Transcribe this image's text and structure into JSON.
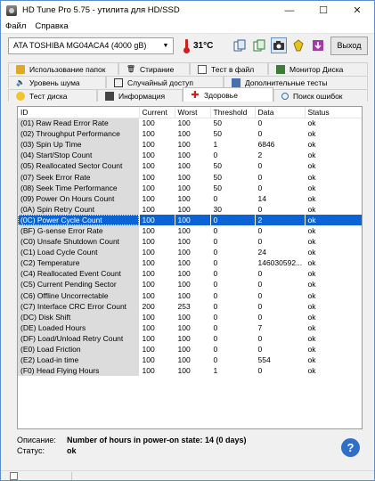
{
  "window": {
    "title": "HD Tune Pro 5.75 - утилита для HD/SSD"
  },
  "controls": {
    "minimize": "—",
    "maximize": "☐",
    "close": "✕"
  },
  "menu": [
    {
      "label": "Файл"
    },
    {
      "label": "Справка"
    }
  ],
  "toolbar": {
    "drive": "ATA    TOSHIBA MG04ACA4 (4000 gB)",
    "temperature": "31°C",
    "exit_label": "Выход",
    "icons": [
      "copy-icon",
      "copy-all-icon",
      "camera-icon",
      "star-icon",
      "download-icon"
    ]
  },
  "tabs": {
    "row1": [
      {
        "label": "Использование папок",
        "icon": "folder-icon"
      },
      {
        "label": "Стирание",
        "icon": "trash-icon"
      },
      {
        "label": "Тест в файл",
        "icon": "file-icon"
      },
      {
        "label": "Монитор Диска",
        "icon": "monitor-icon"
      }
    ],
    "row2": [
      {
        "label": "Уровень шума",
        "icon": "speaker-icon"
      },
      {
        "label": "Случайный доступ",
        "icon": "random-access-icon"
      },
      {
        "label": "Дополнительные  тесты",
        "icon": "tests-icon"
      }
    ],
    "row3": [
      {
        "label": "Тест диска",
        "icon": "bulb-icon"
      },
      {
        "label": "Информация",
        "icon": "info-icon"
      },
      {
        "label": "Здоровье",
        "icon": "health-cross-icon",
        "active": true
      },
      {
        "label": "Поиск ошибок",
        "icon": "magnifier-icon"
      }
    ]
  },
  "table": {
    "columns": [
      "ID",
      "Current",
      "Worst",
      "Threshold",
      "Data",
      "Status"
    ],
    "selected_index": 9,
    "rows": [
      [
        "(01) Raw Read Error Rate",
        "100",
        "100",
        "50",
        "0",
        "ok"
      ],
      [
        "(02) Throughput Performance",
        "100",
        "100",
        "50",
        "0",
        "ok"
      ],
      [
        "(03) Spin Up Time",
        "100",
        "100",
        "1",
        "6846",
        "ok"
      ],
      [
        "(04) Start/Stop Count",
        "100",
        "100",
        "0",
        "2",
        "ok"
      ],
      [
        "(05) Reallocated Sector Count",
        "100",
        "100",
        "50",
        "0",
        "ok"
      ],
      [
        "(07) Seek Error Rate",
        "100",
        "100",
        "50",
        "0",
        "ok"
      ],
      [
        "(08) Seek Time Performance",
        "100",
        "100",
        "50",
        "0",
        "ok"
      ],
      [
        "(09) Power On Hours Count",
        "100",
        "100",
        "0",
        "14",
        "ok"
      ],
      [
        "(0A) Spin Retry Count",
        "100",
        "100",
        "30",
        "0",
        "ok"
      ],
      [
        "(0C) Power Cycle Count",
        "100",
        "100",
        "0",
        "2",
        "ok"
      ],
      [
        "(BF) G-sense Error Rate",
        "100",
        "100",
        "0",
        "0",
        "ok"
      ],
      [
        "(C0) Unsafe Shutdown Count",
        "100",
        "100",
        "0",
        "0",
        "ok"
      ],
      [
        "(C1) Load Cycle Count",
        "100",
        "100",
        "0",
        "24",
        "ok"
      ],
      [
        "(C2) Temperature",
        "100",
        "100",
        "0",
        "146030592...",
        "ok"
      ],
      [
        "(C4) Reallocated Event Count",
        "100",
        "100",
        "0",
        "0",
        "ok"
      ],
      [
        "(C5) Current Pending Sector",
        "100",
        "100",
        "0",
        "0",
        "ok"
      ],
      [
        "(C6) Offline Uncorrectable",
        "100",
        "100",
        "0",
        "0",
        "ok"
      ],
      [
        "(C7) Interface CRC Error Count",
        "200",
        "253",
        "0",
        "0",
        "ok"
      ],
      [
        "(DC) Disk Shift",
        "100",
        "100",
        "0",
        "0",
        "ok"
      ],
      [
        "(DE) Loaded Hours",
        "100",
        "100",
        "0",
        "7",
        "ok"
      ],
      [
        "(DF) Load/Unload Retry Count",
        "100",
        "100",
        "0",
        "0",
        "ok"
      ],
      [
        "(E0) Load Friction",
        "100",
        "100",
        "0",
        "0",
        "ok"
      ],
      [
        "(E2) Load-in time",
        "100",
        "100",
        "0",
        "554",
        "ok"
      ],
      [
        "(F0) Head Flying Hours",
        "100",
        "100",
        "1",
        "0",
        "ok"
      ]
    ]
  },
  "description": {
    "label": "Описание:",
    "value": "Number of hours in power-on state: 14 (0 days)",
    "status_label": "Статус:",
    "status_value": "ok"
  },
  "help_label": "?"
}
